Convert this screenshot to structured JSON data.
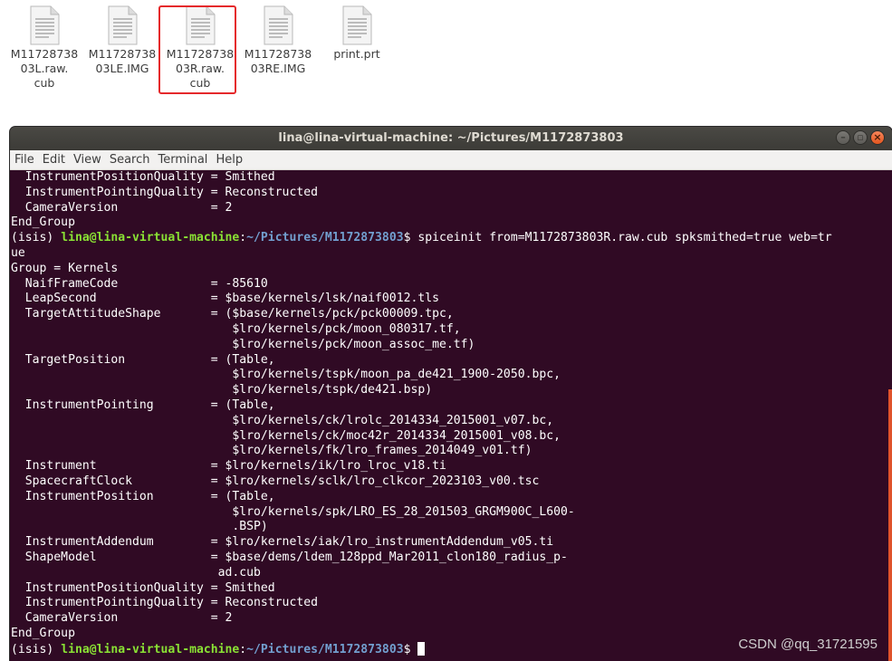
{
  "desktop": {
    "files": [
      {
        "name": "M1172873803L.raw.cub",
        "label": "M11728738\n03L.raw.\ncub",
        "icon": "document-icon"
      },
      {
        "name": "M1172873803LE.IMG",
        "label": "M11728738\n03LE.IMG",
        "icon": "document-icon"
      },
      {
        "name": "M1172873803R.raw.cub",
        "label": "M11728738\n03R.raw.\ncub",
        "icon": "document-icon",
        "highlighted": true
      },
      {
        "name": "M1172873803RE.IMG",
        "label": "M11728738\n03RE.IMG",
        "icon": "document-icon"
      },
      {
        "name": "print.prt",
        "label": "print.prt",
        "icon": "document-icon"
      }
    ],
    "highlight_color": "#e5292b"
  },
  "terminal": {
    "title": "lina@lina-virtual-machine: ~/Pictures/M1172873803",
    "menu": [
      "File",
      "Edit",
      "View",
      "Search",
      "Terminal",
      "Help"
    ],
    "colors": {
      "background": "#300a24",
      "user": "#8ae234",
      "path": "#729fcf",
      "text": "#ffffff"
    },
    "prompt": {
      "env": "(isis) ",
      "user": "lina@lina-virtual-machine",
      "sep": ":",
      "path": "~/Pictures/M1172873803",
      "suffix": "$ "
    },
    "command": "spiceinit from=M1172873803R.raw.cub spksmithed=true web=tr",
    "command_wrap": "ue",
    "lines_before": [
      "  InstrumentPositionQuality = Smithed",
      "  InstrumentPointingQuality = Reconstructed",
      "  CameraVersion             = 2",
      "End_Group"
    ],
    "lines_after": [
      "Group = Kernels",
      "  NaifFrameCode             = -85610",
      "  LeapSecond                = $base/kernels/lsk/naif0012.tls",
      "  TargetAttitudeShape       = ($base/kernels/pck/pck00009.tpc,",
      "                               $lro/kernels/pck/moon_080317.tf,",
      "                               $lro/kernels/pck/moon_assoc_me.tf)",
      "  TargetPosition            = (Table,",
      "                               $lro/kernels/tspk/moon_pa_de421_1900-2050.bpc,",
      "                               $lro/kernels/tspk/de421.bsp)",
      "  InstrumentPointing        = (Table,",
      "                               $lro/kernels/ck/lrolc_2014334_2015001_v07.bc,",
      "                               $lro/kernels/ck/moc42r_2014334_2015001_v08.bc,",
      "                               $lro/kernels/fk/lro_frames_2014049_v01.tf)",
      "  Instrument                = $lro/kernels/ik/lro_lroc_v18.ti",
      "  SpacecraftClock           = $lro/kernels/sclk/lro_clkcor_2023103_v00.tsc",
      "  InstrumentPosition        = (Table,",
      "                               $lro/kernels/spk/LRO_ES_28_201503_GRGM900C_L600-",
      "                               .BSP)",
      "  InstrumentAddendum        = $lro/kernels/iak/lro_instrumentAddendum_v05.ti",
      "  ShapeModel                = $base/dems/ldem_128ppd_Mar2011_clon180_radius_p-",
      "                             ad.cub",
      "  InstrumentPositionQuality = Smithed",
      "  InstrumentPointingQuality = Reconstructed",
      "  CameraVersion             = 2",
      "End_Group"
    ]
  },
  "watermark": "CSDN @qq_31721595"
}
